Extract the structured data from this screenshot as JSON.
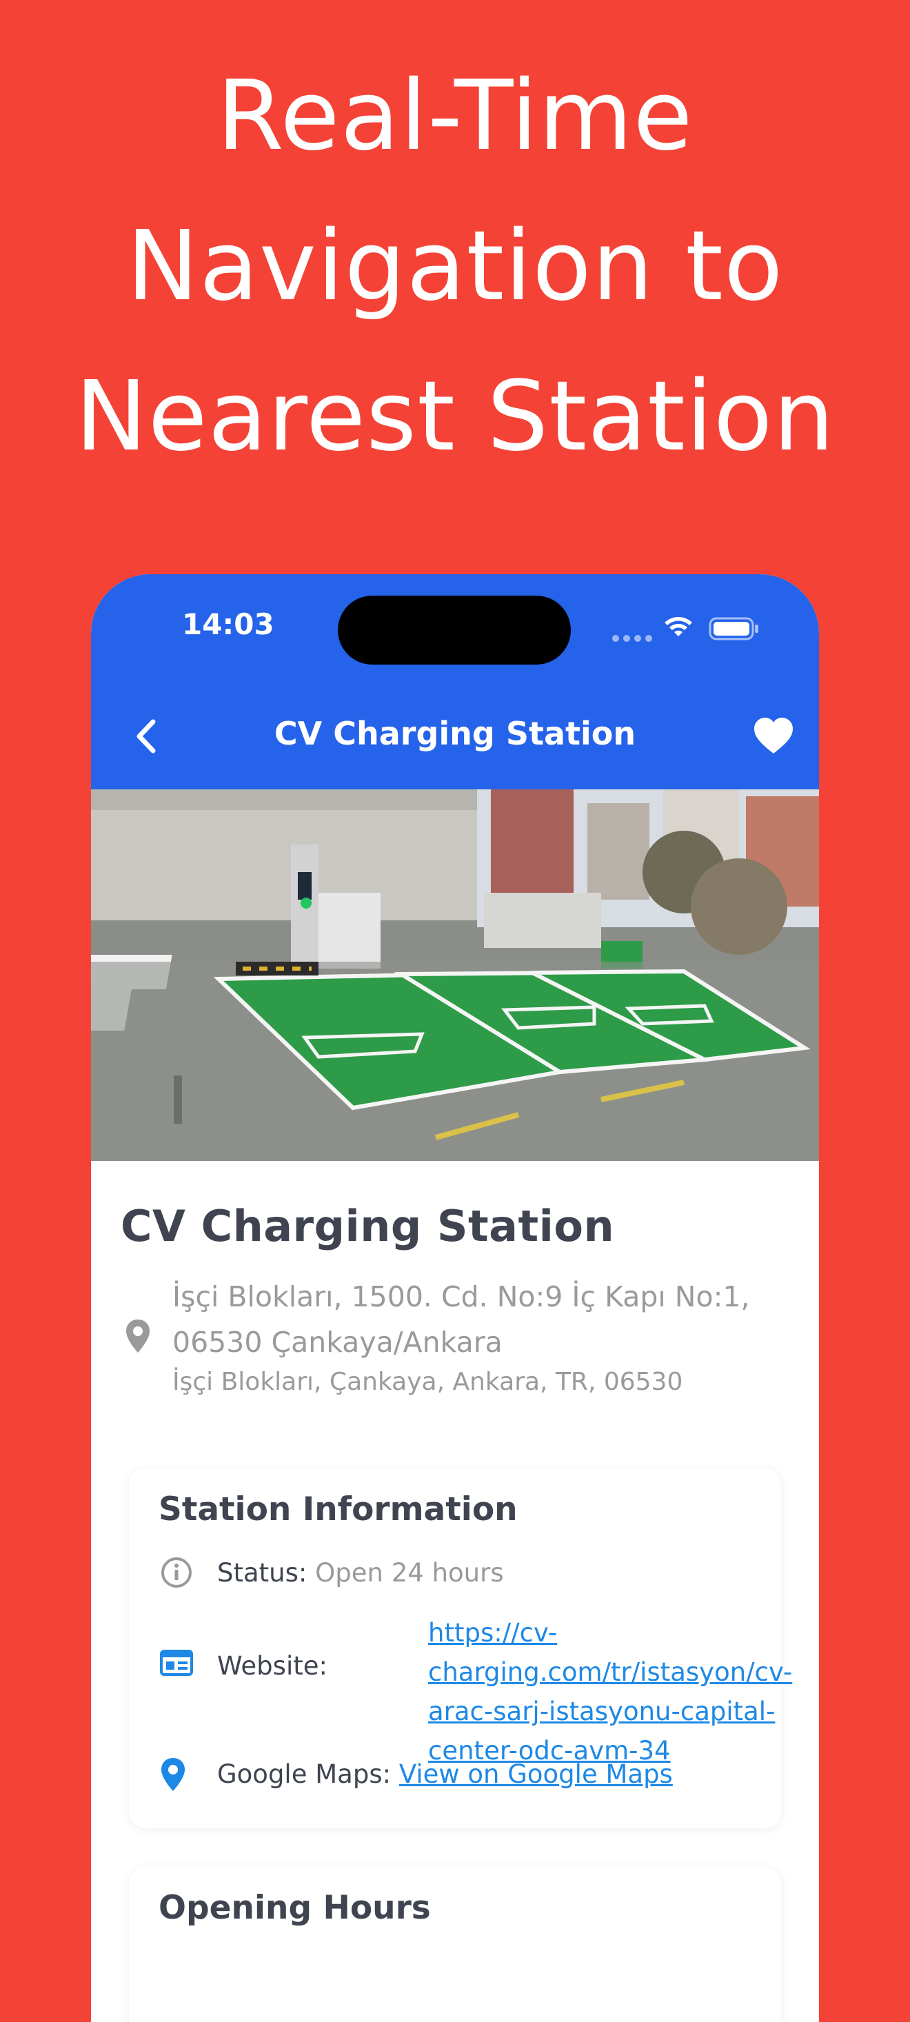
{
  "headline": {
    "line1": "Real-Time",
    "line2": "Navigation to",
    "line3": "Nearest Station"
  },
  "status_bar": {
    "time": "14:03"
  },
  "nav": {
    "title": "CV Charging Station",
    "back_icon": "chevron-left-icon",
    "favorite_icon": "heart-icon"
  },
  "station": {
    "name": "CV Charging Station",
    "address_line": "İşçi Blokları, 1500. Cd. No:9 İç Kapı No:1, 06530 Çankaya/Ankara",
    "address_secondary": "İşçi Blokları, Çankaya, Ankara, TR, 06530"
  },
  "station_info": {
    "title": "Station Information",
    "status_label": "Status:",
    "status_value": "Open 24 hours",
    "website_label": "Website:",
    "website_value": "https://cv-charging.com/tr/istasyon/cv-arac-sarj-istasyonu-capital-center-odc-avm-34",
    "maps_label": "Google Maps:",
    "maps_value": "View on Google Maps"
  },
  "opening_hours": {
    "title": "Opening Hours"
  },
  "colors": {
    "background": "#f44336",
    "app_bar": "#2563eb",
    "link": "#1e88e5",
    "text_dark": "#3f4450",
    "text_muted": "#9a9a9a"
  }
}
